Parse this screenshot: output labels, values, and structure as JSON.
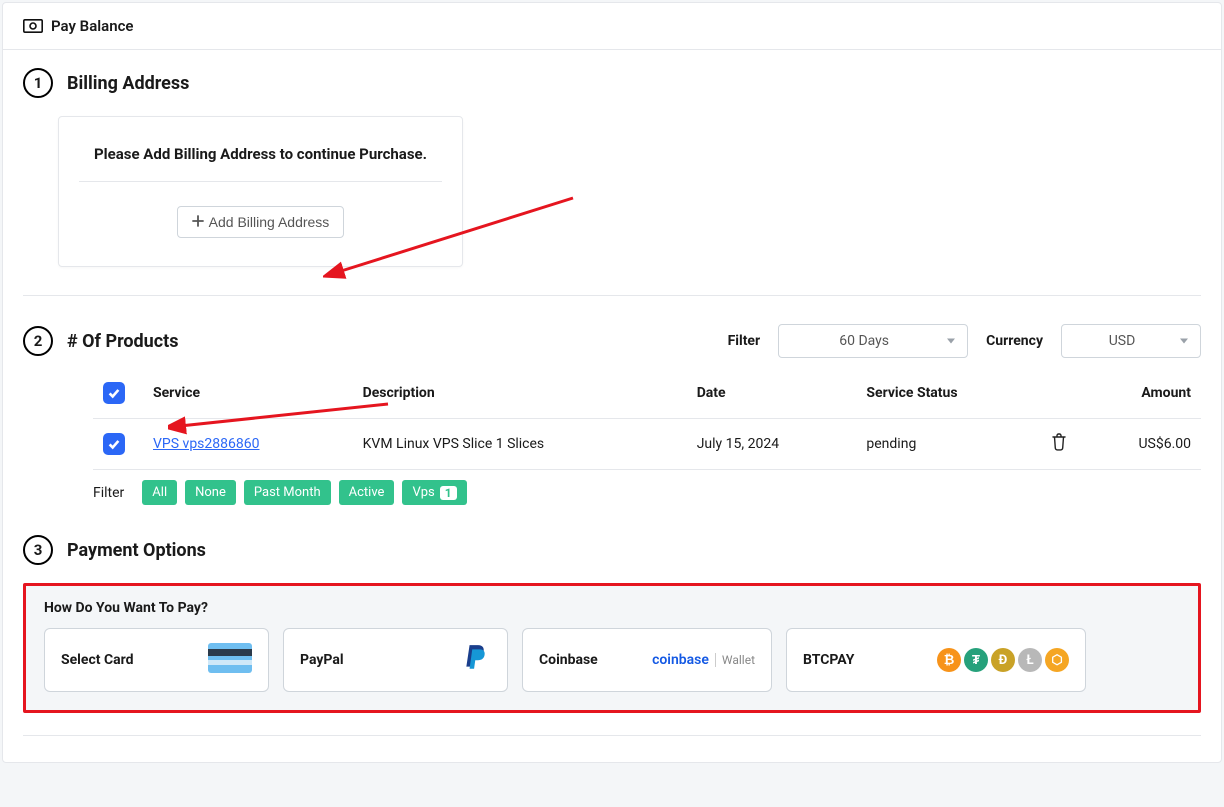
{
  "header": {
    "title": "Pay Balance"
  },
  "steps": {
    "s1": {
      "number": "1",
      "title": "Billing Address"
    },
    "s2": {
      "number": "2",
      "title": "# Of Products"
    },
    "s3": {
      "number": "3",
      "title": "Payment Options"
    }
  },
  "billing": {
    "prompt": "Please Add Billing Address to continue Purchase.",
    "add_button": "Add Billing Address"
  },
  "filters": {
    "filter_label": "Filter",
    "filter_value": "60 Days",
    "currency_label": "Currency",
    "currency_value": "USD"
  },
  "table": {
    "headers": {
      "service": "Service",
      "description": "Description",
      "date": "Date",
      "status": "Service Status",
      "amount": "Amount"
    },
    "rows": [
      {
        "service": "VPS vps2886860",
        "description": "KVM Linux VPS Slice 1 Slices",
        "date": "July 15, 2024",
        "status": "pending",
        "amount": "US$6.00"
      }
    ]
  },
  "pills": {
    "label": "Filter",
    "all": "All",
    "none": "None",
    "past_month": "Past Month",
    "active": "Active",
    "vps": "Vps",
    "vps_count": "1"
  },
  "payment": {
    "title": "How Do You Want To Pay?",
    "select_card": "Select Card",
    "paypal": "PayPal",
    "coinbase": "Coinbase",
    "coinbase_brand": "coinbase",
    "coinbase_wallet": "Wallet",
    "btcpay": "BTCPAY"
  }
}
